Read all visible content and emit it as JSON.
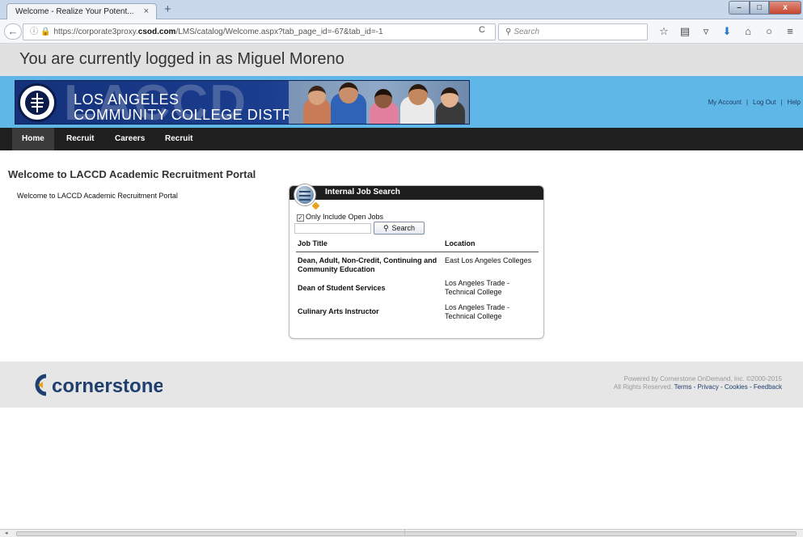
{
  "browser": {
    "tab_title": "Welcome - Realize Your Potent...",
    "tab_close": "×",
    "new_tab": "+",
    "url_prefix": "https://corporate3proxy.",
    "url_domain": "csod.com",
    "url_suffix": "/LMS/catalog/Welcome.aspx?tab_page_id=-67&tab_id=-1",
    "search_placeholder": "Search",
    "icons": [
      "star-icon",
      "reading-list-icon",
      "pocket-icon",
      "download-icon",
      "home-icon",
      "chat-icon",
      "menu-icon"
    ]
  },
  "user_bar": {
    "text": "You are currently logged in as Miguel Moreno"
  },
  "banner": {
    "line1": "LOS ANGELES",
    "line2": "COMMUNITY COLLEGE DISTRICT",
    "ghost_text": "LACCD",
    "account_links": [
      "My Account",
      "Log Out",
      "Help"
    ],
    "separator": "|"
  },
  "menu": {
    "items": [
      "Home",
      "Recruit",
      "Careers",
      "Recruit"
    ]
  },
  "page": {
    "title": "Welcome to LACCD Academic Recruitment Portal",
    "welcome_text": "Welcome to LACCD Academic Recruitment Portal"
  },
  "job_search": {
    "title": "Internal Job Search",
    "checkbox_label": "Only Include Open Jobs",
    "checkbox_checked": true,
    "keyword_value": "",
    "search_button": "Search",
    "columns": [
      "Job Title",
      "Location"
    ],
    "rows": [
      {
        "title": "Dean, Adult, Non-Credit, Continuing and Community Education",
        "location": "East Los Angeles Colleges"
      },
      {
        "title": "Dean of Student Services",
        "location": "Los Angeles Trade -Technical College"
      },
      {
        "title": "Culinary Arts Instructor",
        "location": "Los Angeles Trade -Technical College"
      }
    ]
  },
  "footer": {
    "logo": "cornerstone",
    "powered": "Powered by Cornerstone OnDemand, Inc. ©2000-2015",
    "rights": "All Rights Reserved.",
    "links": [
      "Terms",
      "Privacy",
      "Cookies",
      "Feedback"
    ],
    "link_sep": " - "
  },
  "colors": {
    "banner_bg": "#5fb7e8",
    "menu_bg": "#1f1f1f",
    "banner_navy": "#1b3d8e",
    "cornerstone_navy": "#1f3f6e"
  }
}
